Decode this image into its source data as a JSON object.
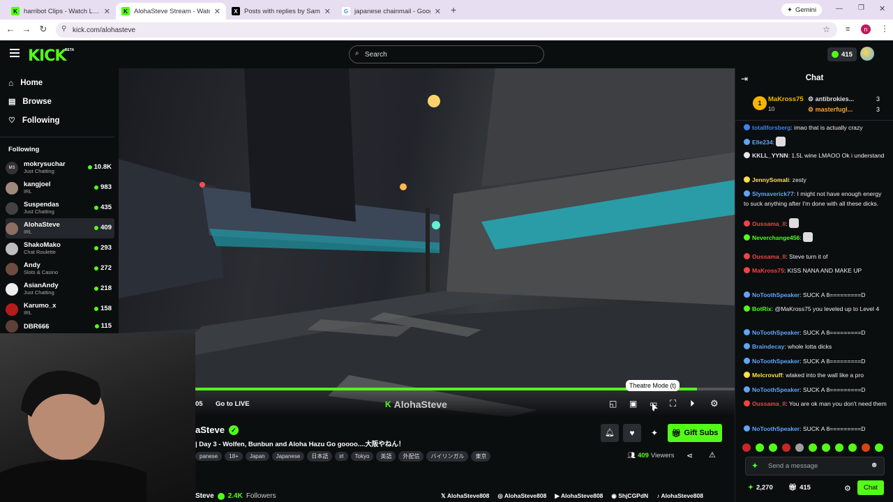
{
  "browser": {
    "tabs": [
      {
        "title": "harribot Clips - Watch Live on K",
        "favicon": "K"
      },
      {
        "title": "AlohaSteve Stream - Watch Live",
        "favicon": "K"
      },
      {
        "title": "Posts with replies by Sam Pepp",
        "favicon": "X"
      },
      {
        "title": "japanese chainmail - Google Se",
        "favicon": "G"
      }
    ],
    "gemini_label": "Gemini",
    "url": "kick.com/alohasteve",
    "profile_initial": "n"
  },
  "header": {
    "logo": "KICK",
    "beta": "BETA",
    "search_placeholder": "Search",
    "points": "415"
  },
  "sidebar": {
    "nav": [
      {
        "label": "Home",
        "icon": "home-icon"
      },
      {
        "label": "Browse",
        "icon": "browse-icon"
      },
      {
        "label": "Following",
        "icon": "heart-icon"
      }
    ],
    "section_title": "Following",
    "following": [
      {
        "name": "mokrysuchar",
        "category": "Just Chatting",
        "viewers": "10.8K"
      },
      {
        "name": "kangjoel",
        "category": "IRL",
        "viewers": "983"
      },
      {
        "name": "Suspendas",
        "category": "Just Chatting",
        "viewers": "435"
      },
      {
        "name": "AlohaSteve",
        "category": "IRL",
        "viewers": "409"
      },
      {
        "name": "ShakoMako",
        "category": "Chat Roulette",
        "viewers": "293"
      },
      {
        "name": "Andy",
        "category": "Slots & Casino",
        "viewers": "272"
      },
      {
        "name": "AsianAndy",
        "category": "Just Chatting",
        "viewers": "218"
      },
      {
        "name": "Karumo_x",
        "category": "IRL",
        "viewers": "158"
      },
      {
        "name": "DBR666",
        "category": "",
        "viewers": "115"
      }
    ]
  },
  "player": {
    "time": "05",
    "go_live": "Go to LIVE",
    "watermark": "AlohaSteve",
    "tooltip": "Theatre Mode (t)",
    "progress": 0.93
  },
  "stream": {
    "streamer": "aSteve",
    "title": "| Day 3 - Wolfen, Bunbun and Aloha Hazu Go goooo....大阪やねん！",
    "tags": [
      "panese",
      "18+",
      "Japan",
      "Japanese",
      "日本語",
      "irl",
      "Tokyo",
      "英語",
      "外配信",
      "バイリンガル",
      "東京"
    ],
    "viewers": "409",
    "viewers_label": "Viewers",
    "gift_subs": "Gift Subs",
    "footer_name": "Steve",
    "followers": "2.4K",
    "followers_label": "Followers",
    "socials": [
      "AlohaSteve808",
      "AlohaSteve808",
      "AlohaSteve808",
      "ShjCGPdN",
      "AlohaSteve808"
    ]
  },
  "chat": {
    "title": "Chat",
    "leaderboard": {
      "top": {
        "name": "MaKross75",
        "count": "10",
        "rank": "1"
      },
      "second": {
        "name": "antibrokies...",
        "count": "3"
      },
      "third": {
        "name": "masterfugl...",
        "count": "3"
      }
    },
    "messages": [
      {
        "user": "totallforsberg",
        "text": "imao that is actually crazy",
        "color": "#3b82f6"
      },
      {
        "user": "Elle234",
        "text": "",
        "color": "#60a5fa"
      },
      {
        "user": "KKLL_YYNN",
        "text": "1.5L wine LMAOO Ok i understand",
        "color": "#e5e7eb"
      },
      {
        "user": "JennySomali",
        "text": "zesty",
        "color": "#fde047"
      },
      {
        "user": "Slymaverick77",
        "text": "I might not have enough energy to suck anything after I'm done with all these dicks.",
        "color": "#60a5fa"
      },
      {
        "user": "Oussama_ll",
        "text": "",
        "color": "#ef4444"
      },
      {
        "user": "Neverchange456",
        "text": "",
        "color": "#53fc18"
      },
      {
        "user": "Oussama_ll",
        "text": "Steve turn it of",
        "color": "#ef4444"
      },
      {
        "user": "MaKross75",
        "text": "KISS NANA AND MAKE UP",
        "color": "#ef4444"
      },
      {
        "user": "NoToothSpeaker",
        "text": "SUCK A 8=========D",
        "color": "#60a5fa"
      },
      {
        "user": "BotRix",
        "text": "@MaKross75 you leveled up to Level 4",
        "color": "#53fc18"
      },
      {
        "user": "NoToothSpeaker",
        "text": "SUCK A 8=========D",
        "color": "#60a5fa"
      },
      {
        "user": "Braindecay",
        "text": "whole lotta dicks",
        "color": "#60a5fa"
      },
      {
        "user": "NoToothSpeaker",
        "text": "SUCK A 8=========D",
        "color": "#60a5fa"
      },
      {
        "user": "Melcrovuff",
        "text": "wlaked into the wall like a pro",
        "color": "#fde047"
      },
      {
        "user": "NoToothSpeaker",
        "text": "SUCK A 8=========D",
        "color": "#60a5fa"
      },
      {
        "user": "Oussama_ll",
        "text": "You are ok man you don't need them",
        "color": "#ef4444"
      },
      {
        "user": "NoToothSpeaker",
        "text": "SUCK A 8=========D",
        "color": "#60a5fa"
      }
    ],
    "input_placeholder": "Send a message",
    "points": "2,270",
    "subs": "415",
    "send_label": "Chat"
  },
  "colors": {
    "accent": "#53fc18",
    "bg": "#0b0e0f"
  }
}
